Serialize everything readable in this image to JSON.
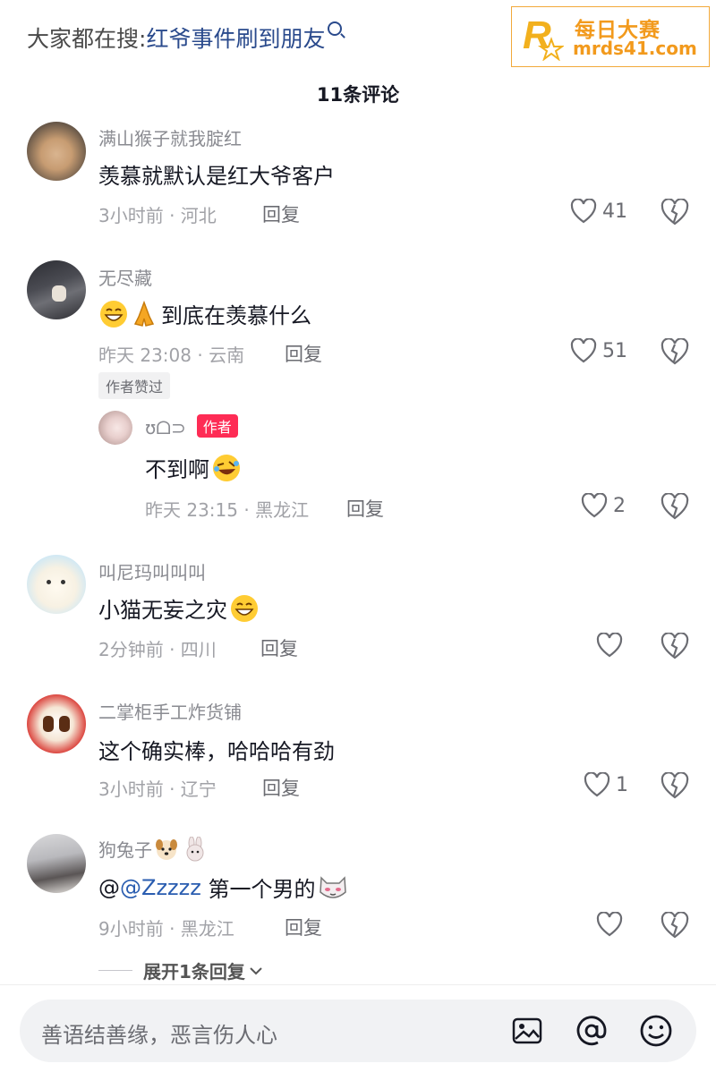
{
  "search": {
    "prefix": "大家都在搜:",
    "query": "红爷事件刷到朋友"
  },
  "watermark": {
    "cn": "每日大赛",
    "url": "mrds41.com"
  },
  "comments_title": "11条评论",
  "comments": [
    {
      "username": "满山猴子就我腚红",
      "text": "羡慕就默认是红大爷客户",
      "meta": "3小时前 · 河北",
      "reply": "回复",
      "likes": "41"
    },
    {
      "username": "无尽藏",
      "text": "到底在羡慕什么",
      "meta": "昨天 23:08 · 云南",
      "reply": "回复",
      "likes": "51",
      "badge": "作者赞过"
    },
    {
      "username": "ʊᗝ⊃",
      "author_tag": "作者",
      "text": "不到啊",
      "meta": "昨天 23:15 · 黑龙江",
      "reply": "回复",
      "likes": "2"
    },
    {
      "username": "叫尼玛叫叫叫",
      "text": "小猫无妄之灾",
      "meta": "2分钟前 · 四川",
      "reply": "回复",
      "likes": ""
    },
    {
      "username": "二掌柜手工炸货铺",
      "text": "这个确实棒，哈哈哈有劲",
      "meta": "3小时前 · 辽宁",
      "reply": "回复",
      "likes": "1"
    },
    {
      "username": "狗兔子",
      "text_prefix": "@",
      "mention": "@Zzzzz",
      "text": " 第一个男的",
      "meta": "9小时前 · 黑龙江",
      "reply": "回复",
      "likes": ""
    }
  ],
  "expand": "展开1条回复",
  "input": {
    "placeholder": "善语结善缘，恶言伤人心"
  },
  "icons": [
    "search-icon",
    "heart-icon",
    "dislike-heart-icon",
    "image-icon",
    "at-icon",
    "emoji-icon",
    "chevron-down-icon"
  ],
  "colors": {
    "accent": "#fe2c55",
    "link": "#2a5db0",
    "watermark": "#f29a1d"
  }
}
